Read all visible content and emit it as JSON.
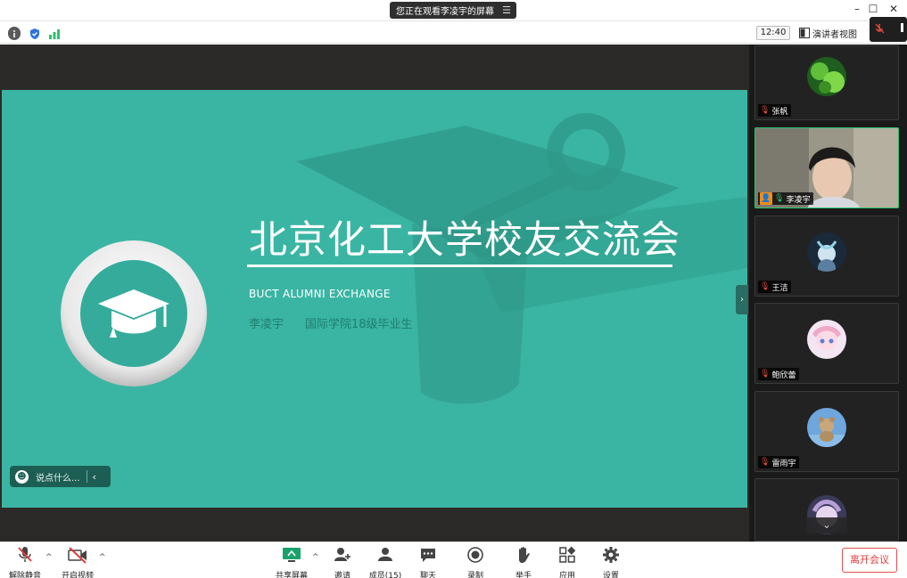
{
  "titlebar": {
    "share_notice": "您正在观看李凌宇的屏幕",
    "menu_glyph": "☰",
    "minimize": "–",
    "maximize": "☐",
    "close": "✕"
  },
  "toprow": {
    "clock": "12:40",
    "speaker_view": "演讲者视图"
  },
  "slide": {
    "title": "北京化工大学校友交流会",
    "subtitle": "BUCT ALUMNI EXCHANGE",
    "presenter": "李凌宇",
    "department": "国际学院18级毕业生"
  },
  "chat": {
    "placeholder": "说点什么..."
  },
  "participants": [
    {
      "name": "张帆",
      "muted": true
    },
    {
      "name": "李凌宇",
      "muted": false,
      "host": true
    },
    {
      "name": "王洁",
      "muted": true
    },
    {
      "name": "鲍欣蕾",
      "muted": true
    },
    {
      "name": "雷雨宇",
      "muted": true
    }
  ],
  "toolbar": {
    "unmute": "解除静音",
    "start_video": "开启视频",
    "share_screen": "共享屏幕",
    "invite": "邀请",
    "members": "成员(15)",
    "chat": "聊天",
    "record": "录制",
    "raise_hand": "举手",
    "apps": "应用",
    "settings": "设置",
    "leave": "离开会议"
  },
  "colors": {
    "slide_bg": "#3ab5a3",
    "leave_red": "#e03c3c",
    "active_green": "#2ec26b",
    "host_orange": "#f08c1a"
  }
}
